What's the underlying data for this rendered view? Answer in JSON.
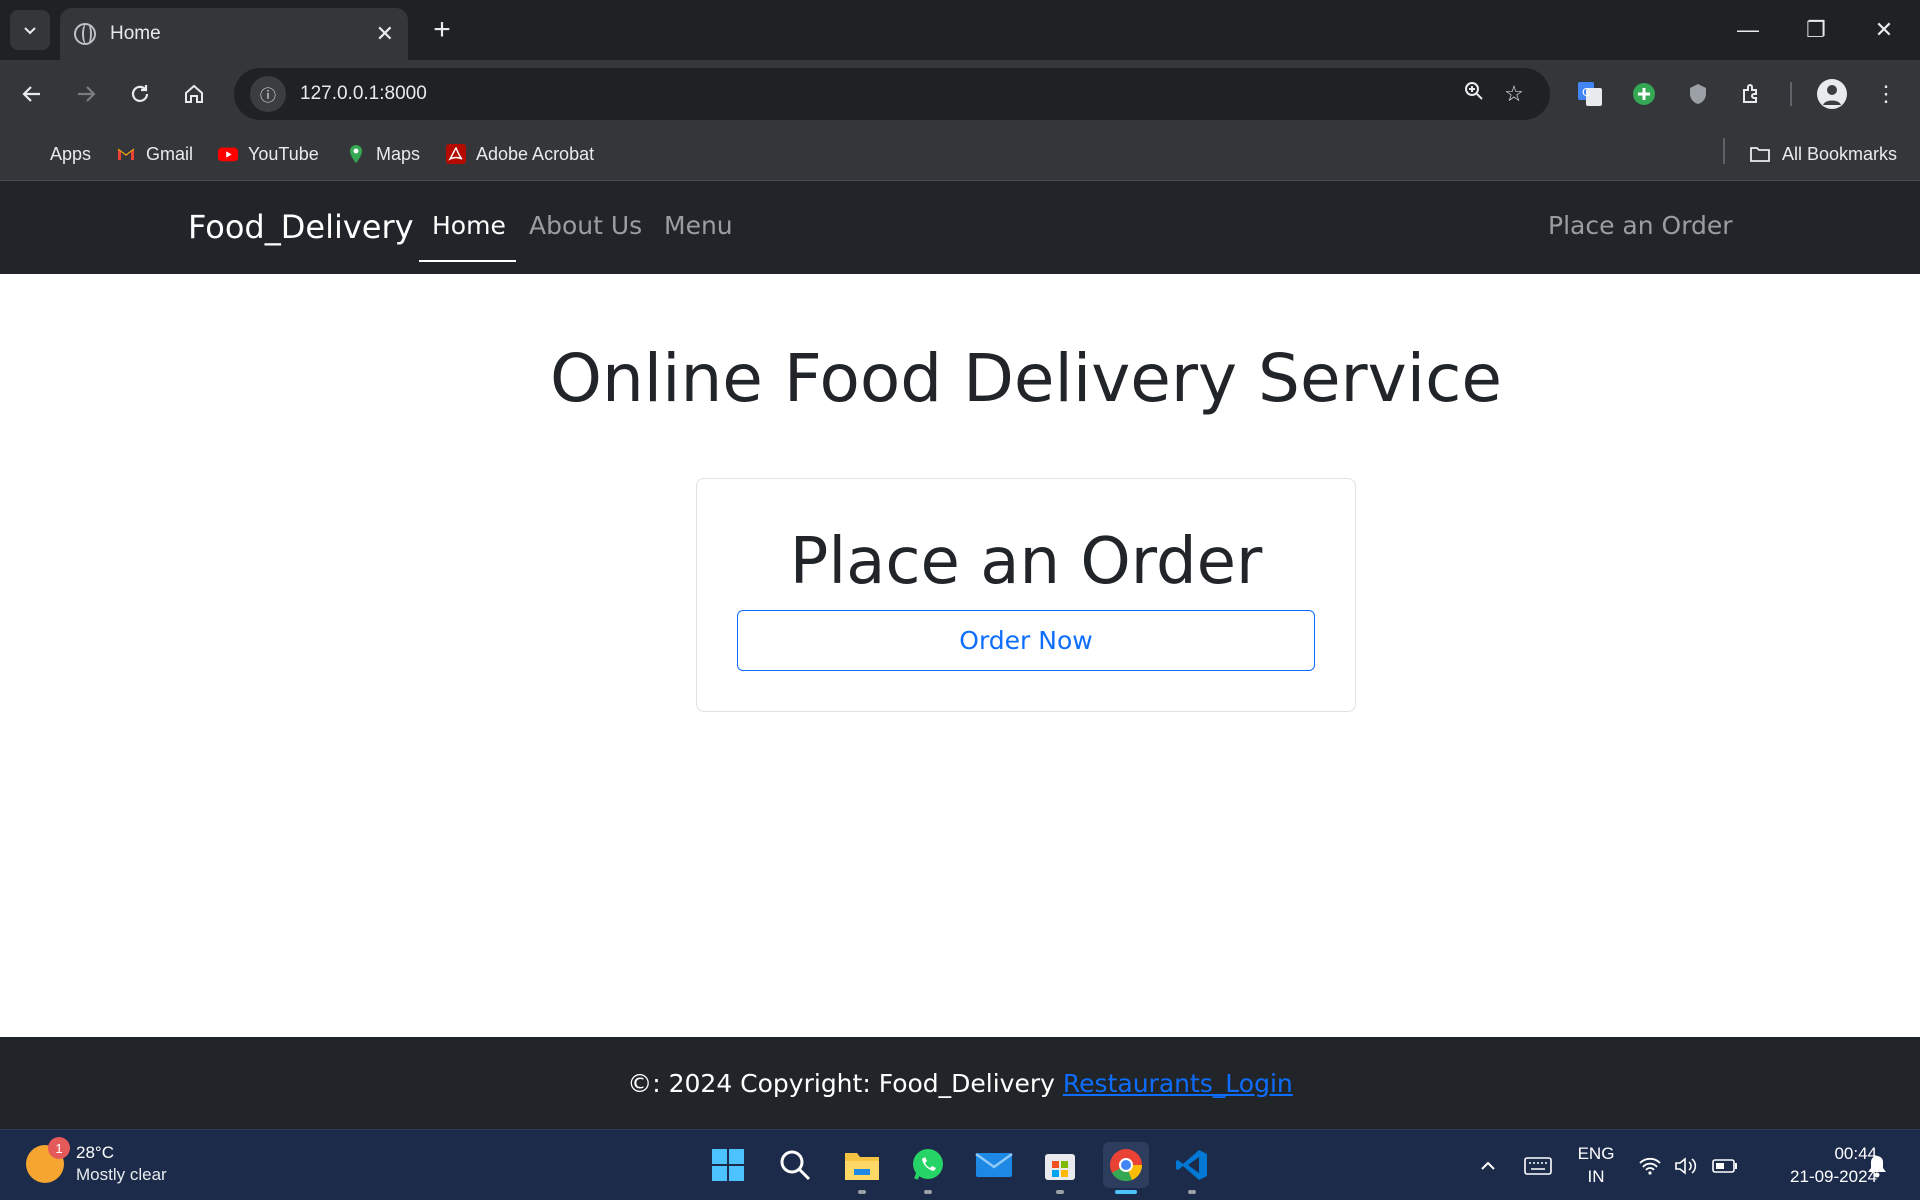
{
  "browser": {
    "tab_title": "Home",
    "url": "127.0.0.1:8000",
    "bookmarks": [
      {
        "label": "Apps",
        "icon": "apps-grid-icon"
      },
      {
        "label": "Gmail",
        "icon": "gmail-icon"
      },
      {
        "label": "YouTube",
        "icon": "youtube-icon"
      },
      {
        "label": "Maps",
        "icon": "maps-pin-icon"
      },
      {
        "label": "Adobe Acrobat",
        "icon": "acrobat-icon"
      }
    ],
    "all_bookmarks": "All Bookmarks"
  },
  "site": {
    "brand": "Food_Delivery",
    "nav": [
      {
        "label": "Home",
        "active": true
      },
      {
        "label": "About Us",
        "active": false
      },
      {
        "label": "Menu",
        "active": false
      }
    ],
    "nav_right": "Place an Order",
    "heading": "Online Food Delivery Service",
    "card": {
      "title": "Place an Order",
      "button": "Order Now"
    },
    "footer": {
      "text": "©: 2024 Copyright: Food_Delivery",
      "link": "Restaurants_Login"
    },
    "colors": {
      "navbar": "#212529",
      "primary": "#0d6efd"
    }
  },
  "taskbar": {
    "weather_temp": "28°C",
    "weather_cond": "Mostly clear",
    "weather_badge": "1",
    "lang_top": "ENG",
    "lang_bottom": "IN",
    "time": "00:44",
    "date": "21-09-2024"
  }
}
